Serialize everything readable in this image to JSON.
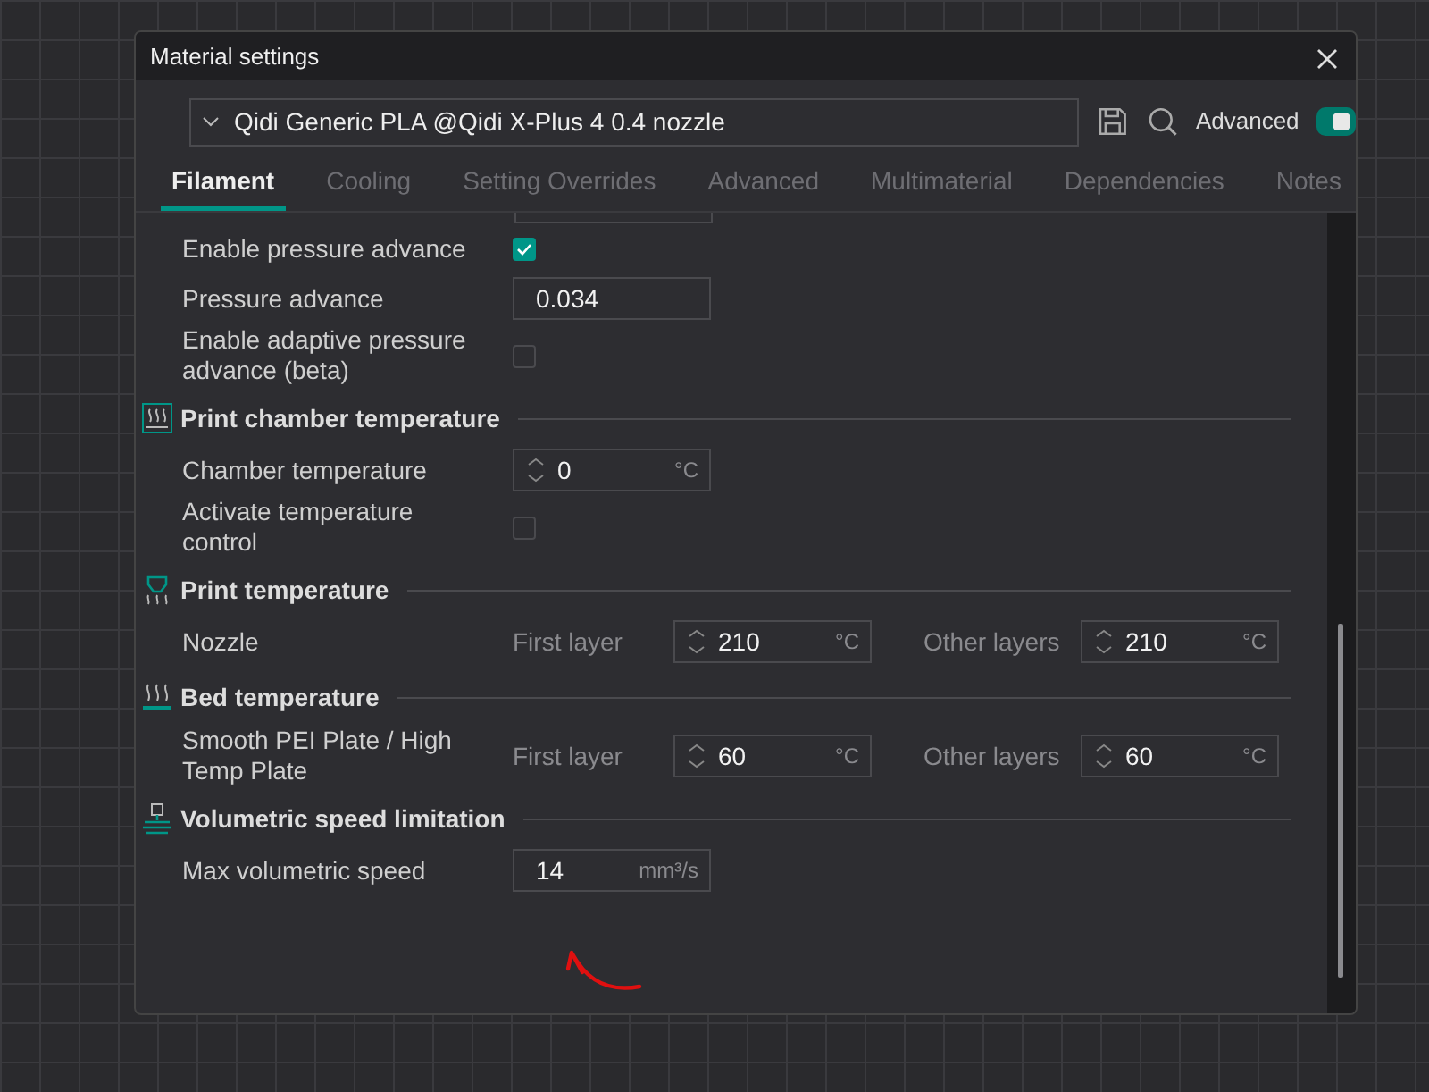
{
  "window": {
    "title": "Material settings"
  },
  "preset": {
    "value": "Qidi Generic PLA @Qidi X-Plus 4 0.4 nozzle"
  },
  "advanced": {
    "label": "Advanced",
    "on": true
  },
  "tabs": [
    {
      "label": "Filament",
      "selected": true
    },
    {
      "label": "Cooling",
      "selected": false
    },
    {
      "label": "Setting Overrides",
      "selected": false
    },
    {
      "label": "Advanced",
      "selected": false
    },
    {
      "label": "Multimaterial",
      "selected": false
    },
    {
      "label": "Dependencies",
      "selected": false
    },
    {
      "label": "Notes",
      "selected": false
    }
  ],
  "sections": [
    {
      "rows": [
        {
          "kind": "checkbox",
          "label": "Enable pressure advance",
          "checked": true
        },
        {
          "kind": "text",
          "label": "Pressure advance",
          "value": "0.034"
        },
        {
          "kind": "checkbox",
          "label": "Enable adaptive pressure advance (beta)",
          "checked": false
        }
      ]
    },
    {
      "title": "Print chamber temperature",
      "rows": [
        {
          "kind": "spin",
          "label": "Chamber temperature",
          "value": "0",
          "unit": "°C"
        },
        {
          "kind": "checkbox",
          "label": "Activate temperature control",
          "checked": false
        }
      ]
    },
    {
      "title": "Print temperature",
      "rows": [
        {
          "kind": "dual",
          "label": "Nozzle",
          "first_label": "First layer",
          "first_value": "210",
          "first_unit": "°C",
          "other_label": "Other layers",
          "other_value": "210",
          "other_unit": "°C"
        }
      ]
    },
    {
      "title": "Bed temperature",
      "rows": [
        {
          "kind": "dual",
          "label": "Smooth PEI Plate / High Temp Plate",
          "first_label": "First layer",
          "first_value": "60",
          "first_unit": "°C",
          "other_label": "Other layers",
          "other_value": "60",
          "other_unit": "°C"
        }
      ]
    },
    {
      "title": "Volumetric speed limitation",
      "rows": [
        {
          "kind": "unit",
          "label": "Max volumetric speed",
          "value": "14",
          "unit": "mm³/s"
        }
      ]
    }
  ]
}
